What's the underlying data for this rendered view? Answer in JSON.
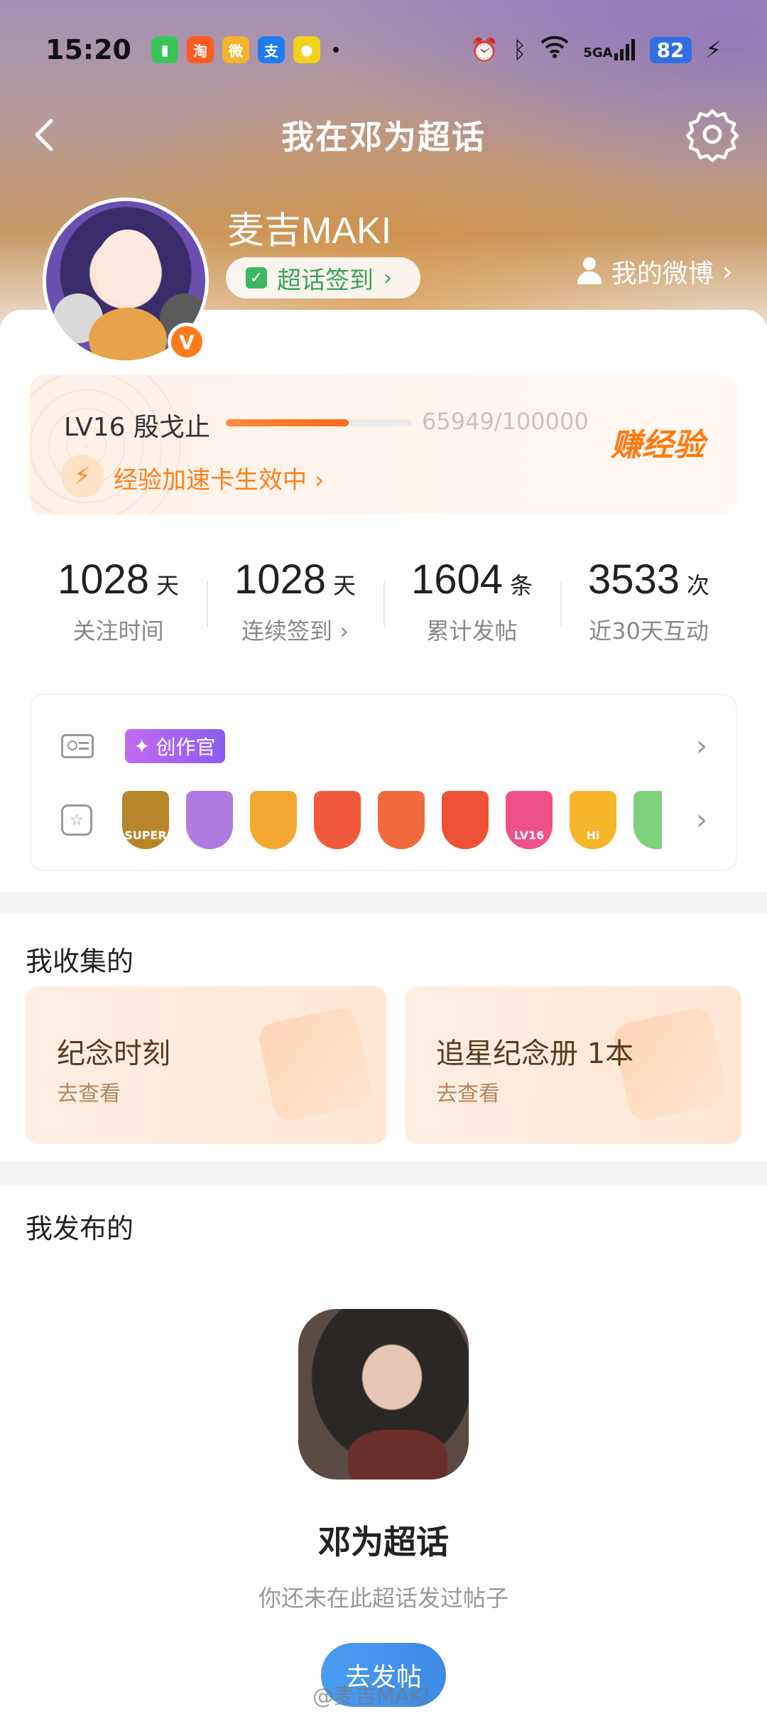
{
  "status_bar": {
    "time": "15:20",
    "apps": [
      {
        "name": "battery-saver-app",
        "glyph": "▮",
        "color": "#3cc45a"
      },
      {
        "name": "taobao-app",
        "glyph": "淘",
        "color": "#ff5a1f"
      },
      {
        "name": "weibo-app",
        "glyph": "微",
        "color": "#f5b52a"
      },
      {
        "name": "alipay-app",
        "glyph": "支",
        "color": "#1f7cf0"
      },
      {
        "name": "other-app",
        "glyph": "●",
        "color": "#f0d21a"
      }
    ],
    "signal_label": "5GA",
    "battery": "82"
  },
  "nav": {
    "title": "我在邓为超话"
  },
  "profile": {
    "username": "麦吉MAKI",
    "checkin_label": "超话签到",
    "my_weibo_label": "我的微博",
    "verified_badge": "V"
  },
  "level": {
    "label": "LV16 殷戈止",
    "progress_text": "65949/100000",
    "progress_fraction": 0.65949,
    "earn_label": "赚经验",
    "boost_label": "经验加速卡生效中"
  },
  "stats": [
    {
      "value": "1028",
      "unit": "天",
      "label": "关注时间"
    },
    {
      "value": "1028",
      "unit": "天",
      "label": "连续签到"
    },
    {
      "value": "1604",
      "unit": "条",
      "label": "累计发帖"
    },
    {
      "value": "3533",
      "unit": "次",
      "label": "近30天互动"
    }
  ],
  "badges": {
    "creator_tag": "创作官",
    "medals": [
      {
        "name": "super-medal",
        "text": "SUPER",
        "color": "#b8862a"
      },
      {
        "name": "character-medal",
        "text": "",
        "color": "#b07be0"
      },
      {
        "name": "crown-medal",
        "text": "",
        "color": "#f3a832"
      },
      {
        "name": "dragon-medal-1",
        "text": "",
        "color": "#f05a3a"
      },
      {
        "name": "dragon-medal-2",
        "text": "",
        "color": "#f06a3e"
      },
      {
        "name": "dragon-medal-3",
        "text": "",
        "color": "#ee5236"
      },
      {
        "name": "lv16-medal",
        "text": "LV16",
        "color": "#f0508a"
      },
      {
        "name": "hi-medal",
        "text": "Hi",
        "color": "#f6b52a"
      },
      {
        "name": "green-medal",
        "text": "",
        "color": "#7fd07a"
      }
    ]
  },
  "collection": {
    "title": "我收集的",
    "cards": [
      {
        "title": "纪念时刻",
        "sub": "去查看"
      },
      {
        "title": "追星纪念册 1本",
        "sub": "去查看"
      }
    ]
  },
  "posts": {
    "title": "我发布的",
    "topic_name": "邓为超话",
    "empty_text": "你还未在此超话发过帖子",
    "post_button": "去发帖"
  },
  "watermark": "@麦吉MAKI"
}
